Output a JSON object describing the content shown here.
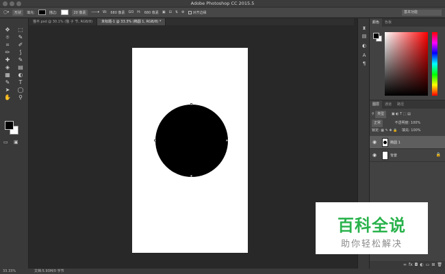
{
  "app": {
    "title": "Adobe Photoshop CC 2015.5"
  },
  "options_bar": {
    "tool_mode": "形状",
    "fill_label": "填充:",
    "stroke_label": "描边:",
    "stroke_width": "20 像素",
    "width_label": "W:",
    "width_value": "680 像素",
    "link_icon": "GO",
    "height_label": "H:",
    "height_value": "680 像素",
    "align_edges": "对齐边缘",
    "workspace": "基本功能"
  },
  "tabs": [
    {
      "label": "猫平.psd @ 30.1% (猫 子 节, RGB/8)"
    },
    {
      "label": "未标题-1 @ 33.3% (椭圆 1, RGB/8) *"
    }
  ],
  "tools": [
    "✥",
    "⬚",
    "⌾",
    "✎",
    "⌗",
    "✐",
    "✏",
    "⟆",
    "✚",
    "✎",
    "◈",
    "▤",
    "▦",
    "◐",
    "✎",
    "T",
    "➤",
    "◯",
    "✋",
    "⚲"
  ],
  "color_panel": {
    "tabs": [
      "颜色",
      "色板"
    ]
  },
  "layers_panel": {
    "tabs": [
      "图层",
      "通道",
      "路径"
    ],
    "kind_filter": "类型",
    "blend_mode": "正常",
    "opacity_label": "不透明度:",
    "opacity_value": "100%",
    "lock_label": "锁定:",
    "fill_label": "填充:",
    "fill_value": "100%",
    "layers": [
      {
        "name": "椭圆 1",
        "selected": true
      },
      {
        "name": "背景",
        "selected": false
      }
    ]
  },
  "status": {
    "zoom": "33.33%",
    "doc_info": "文档:5.93M/0 字节"
  },
  "watermark": {
    "title": "百科全说",
    "subtitle": "助你轻松解决"
  },
  "colors": {
    "accent": "#28b24b",
    "panel": "#424242",
    "canvas_bg": "#282828"
  }
}
